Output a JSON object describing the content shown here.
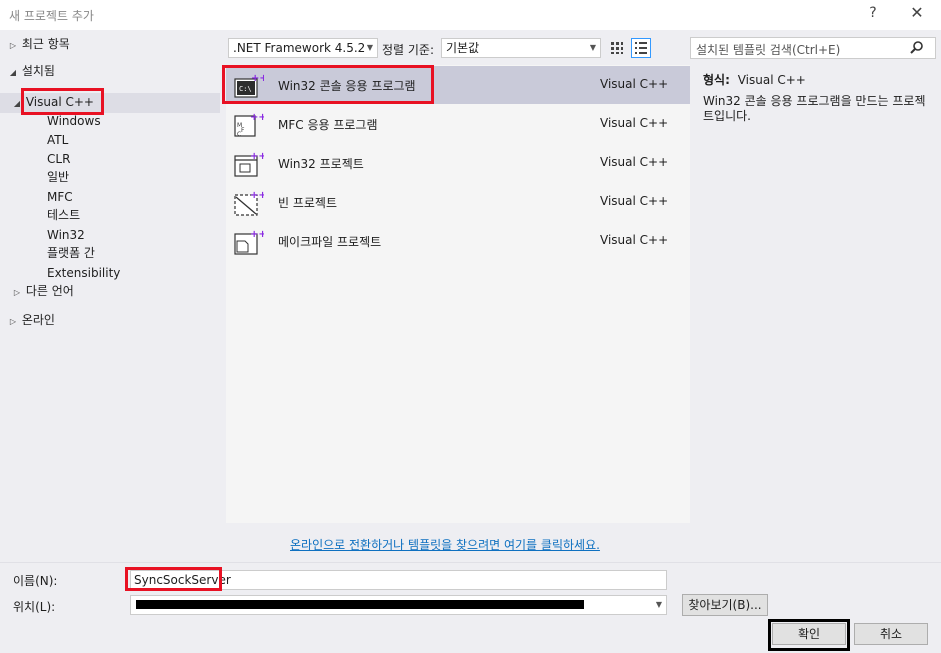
{
  "window": {
    "title": "새 프로젝트 추가",
    "help": "?",
    "close": "✕"
  },
  "tree": {
    "recent": "최근 항목",
    "installed": "설치됨",
    "visual_cpp": "Visual C++",
    "children": [
      "Windows",
      "ATL",
      "CLR",
      "일반",
      "MFC",
      "테스트",
      "Win32",
      "플랫폼 간",
      "Extensibility"
    ],
    "other_languages": "다른 언어",
    "online": "온라인"
  },
  "toolbar": {
    "framework": ".NET Framework 4.5.2",
    "sort_label": "정렬 기준:",
    "sort_value": "기본값"
  },
  "search": {
    "placeholder": "설치된 템플릿 검색(Ctrl+E)"
  },
  "templates": [
    {
      "name": "Win32 콘솔 응용 프로그램",
      "lang": "Visual C++",
      "icon": "console-app-icon"
    },
    {
      "name": "MFC 응용 프로그램",
      "lang": "Visual C++",
      "icon": "mfc-app-icon"
    },
    {
      "name": "Win32 프로젝트",
      "lang": "Visual C++",
      "icon": "win32-project-icon"
    },
    {
      "name": "빈 프로젝트",
      "lang": "Visual C++",
      "icon": "empty-project-icon"
    },
    {
      "name": "메이크파일 프로젝트",
      "lang": "Visual C++",
      "icon": "makefile-project-icon"
    }
  ],
  "details": {
    "type_label": "형식:",
    "type_value": "Visual C++",
    "description": "Win32 콘솔 응용 프로그램을 만드는 프로젝트입니다."
  },
  "online_link": "온라인으로 전환하거나 템플릿을 찾으려면 여기를 클릭하세요.",
  "form": {
    "name_label": "이름(N):",
    "name_value": "SyncSockServer",
    "location_label": "위치(L):",
    "browse": "찾아보기(B)...",
    "ok": "확인",
    "cancel": "취소"
  },
  "colors": {
    "highlight_red": "#e81123",
    "link": "#0e70c0",
    "selection": "#c9cad9",
    "cpp_plus": "#8a2be2"
  }
}
